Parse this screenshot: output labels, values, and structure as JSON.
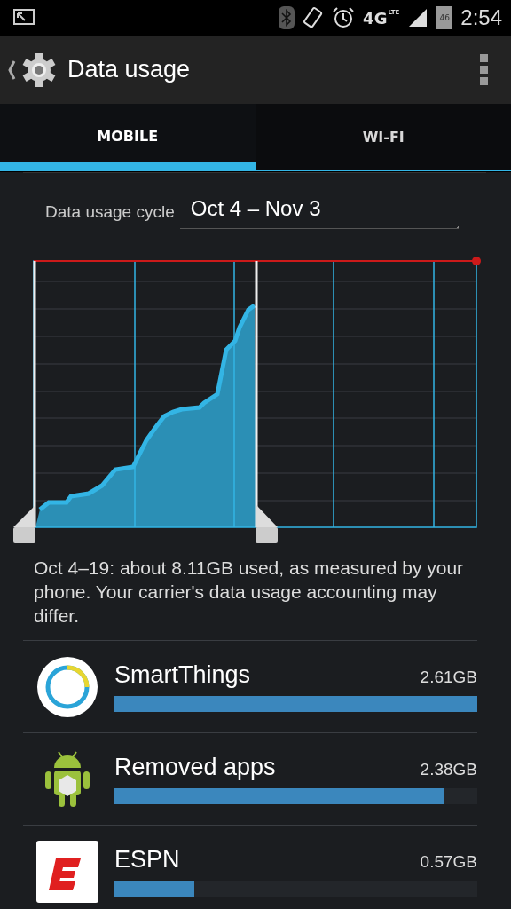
{
  "status_bar": {
    "network": "4G",
    "network_sub": "LTE",
    "battery": "46",
    "time": "2:54"
  },
  "action_bar": {
    "title": "Data usage"
  },
  "tabs": [
    {
      "label": "MOBILE",
      "selected": true
    },
    {
      "label": "WI-FI",
      "selected": false
    }
  ],
  "cycle": {
    "label": "Data usage cycle",
    "value": "Oct 4 – Nov 3"
  },
  "summary": "Oct 4–19: about 8.11GB used, as measured by your phone. Your carrier's data usage accounting may differ.",
  "apps": [
    {
      "name": "SmartThings",
      "usage": "2.61GB",
      "level": 1.0,
      "kind": "ring"
    },
    {
      "name": "Removed apps",
      "usage": "2.38GB",
      "level": 0.91,
      "kind": "robot"
    },
    {
      "name": "ESPN",
      "usage": "0.57GB",
      "level": 0.22,
      "kind": "letter"
    }
  ]
}
